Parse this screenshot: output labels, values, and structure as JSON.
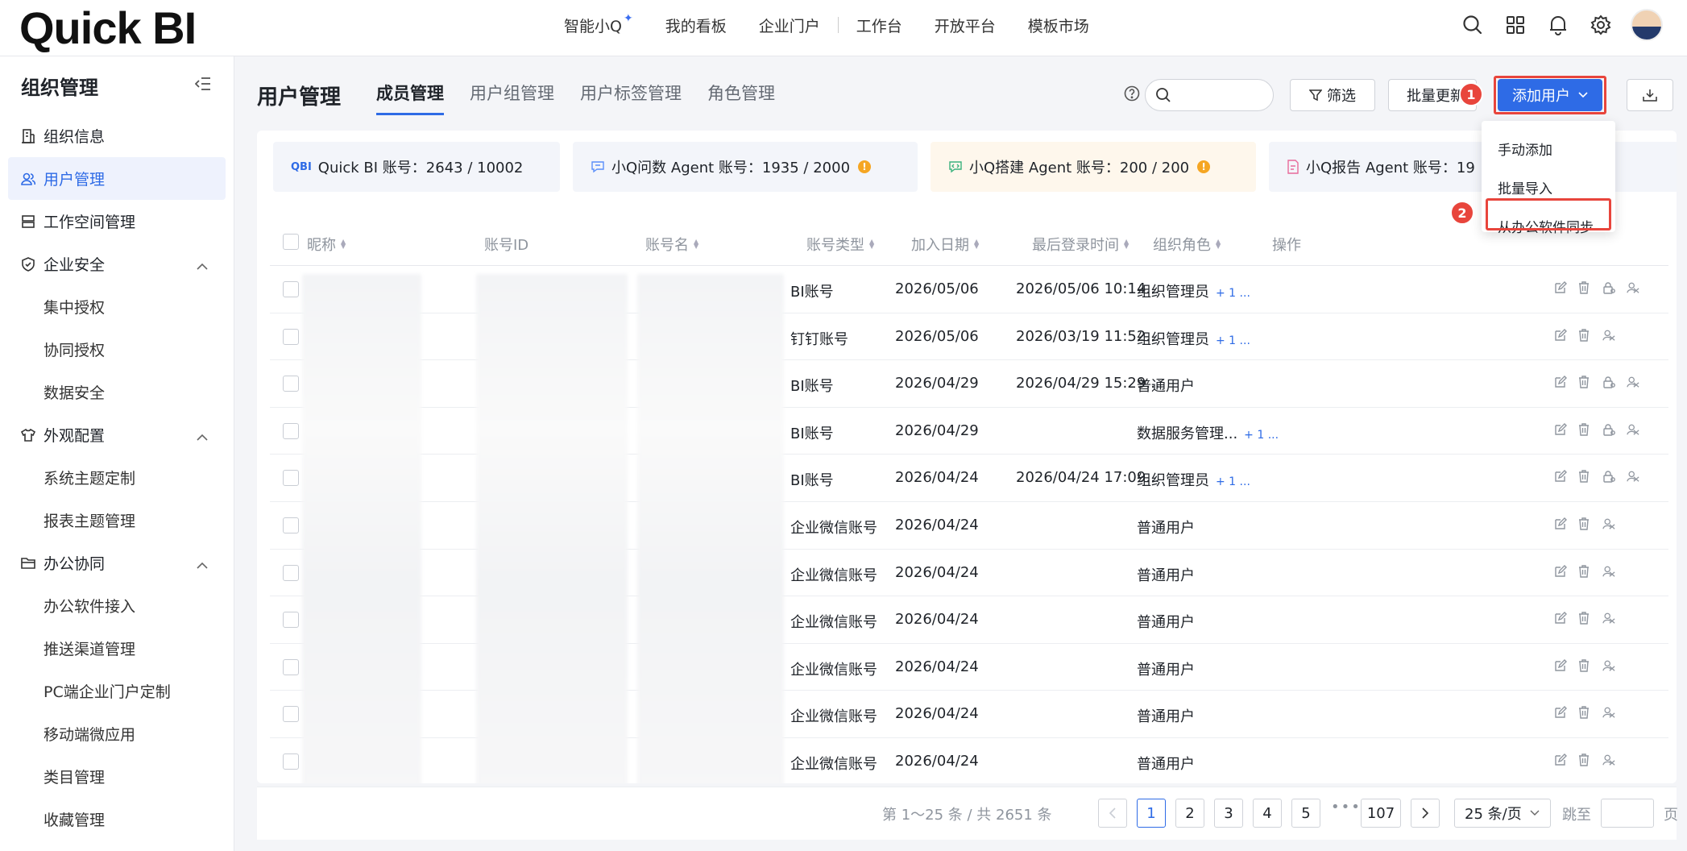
{
  "app": {
    "logo": "Quick BI"
  },
  "nav": {
    "items": [
      "智能小Q",
      "我的看板",
      "企业门户",
      "工作台",
      "开放平台",
      "模板市场"
    ]
  },
  "sidebar": {
    "title": "组织管理",
    "items": [
      {
        "label": "组织信息"
      },
      {
        "label": "用户管理"
      },
      {
        "label": "工作空间管理"
      },
      {
        "label": "企业安全"
      },
      {
        "label": "集中授权"
      },
      {
        "label": "协同授权"
      },
      {
        "label": "数据安全"
      },
      {
        "label": "外观配置"
      },
      {
        "label": "系统主题定制"
      },
      {
        "label": "报表主题管理"
      },
      {
        "label": "办公协同"
      },
      {
        "label": "办公软件接入"
      },
      {
        "label": "推送渠道管理"
      },
      {
        "label": "PC端企业门户定制"
      },
      {
        "label": "移动端微应用"
      },
      {
        "label": "类目管理"
      },
      {
        "label": "收藏管理"
      }
    ]
  },
  "main": {
    "title": "用户管理",
    "tabs": [
      "成员管理",
      "用户组管理",
      "用户标签管理",
      "角色管理"
    ],
    "toolbar": {
      "search_placeholder": "",
      "filter_label": "筛选",
      "bulk_label": "批量更新",
      "add_label": "添加用户"
    },
    "steps": [
      "1",
      "2"
    ],
    "dropdown": [
      "手动添加",
      "批量导入",
      "从办公软件同步"
    ],
    "quota": [
      {
        "prefix": "QBI",
        "label": "Quick BI 账号：2643 / 10002"
      },
      {
        "label": "小Q问数 Agent 账号：1935 / 2000"
      },
      {
        "label": "小Q搭建 Agent 账号：200 / 200"
      },
      {
        "label": "小Q报告 Agent 账号：19"
      }
    ],
    "warn_glyph": "!"
  },
  "table": {
    "columns": [
      "昵称",
      "账号ID",
      "账号名",
      "账号类型",
      "加入日期",
      "最后登录时间",
      "组织角色",
      "操作"
    ],
    "rows": [
      {
        "type": "BI账号",
        "date": "2026/05/06",
        "last": "2026/05/06 10:14...",
        "role": "组织管理员",
        "more": "+ 1 ..."
      },
      {
        "type": "钉钉账号",
        "date": "2026/05/06",
        "last": "2026/03/19 11:52...",
        "role": "组织管理员",
        "more": "+ 1 ..."
      },
      {
        "type": "BI账号",
        "date": "2026/04/29",
        "last": "2026/04/29 15:29...",
        "role": "普通用户",
        "more": ""
      },
      {
        "type": "BI账号",
        "date": "2026/04/29",
        "last": "",
        "role": "数据服务管理...",
        "more": "+ 1 ..."
      },
      {
        "type": "BI账号",
        "date": "2026/04/24",
        "last": "2026/04/24 17:09...",
        "role": "组织管理员",
        "more": "+ 1 ..."
      },
      {
        "type": "企业微信账号",
        "date": "2026/04/24",
        "last": "",
        "role": "普通用户",
        "more": ""
      },
      {
        "type": "企业微信账号",
        "date": "2026/04/24",
        "last": "",
        "role": "普通用户",
        "more": ""
      },
      {
        "type": "企业微信账号",
        "date": "2026/04/24",
        "last": "",
        "role": "普通用户",
        "more": ""
      },
      {
        "type": "企业微信账号",
        "date": "2026/04/24",
        "last": "",
        "role": "普通用户",
        "more": ""
      },
      {
        "type": "企业微信账号",
        "date": "2026/04/24",
        "last": "",
        "role": "普通用户",
        "more": ""
      },
      {
        "type": "企业微信账号",
        "date": "2026/04/24",
        "last": "",
        "role": "普通用户",
        "more": ""
      }
    ]
  },
  "pagination": {
    "total": "第 1～25 条 / 共 2651 条",
    "pages": [
      "1",
      "2",
      "3",
      "4",
      "5"
    ],
    "last_page": "107",
    "ellipsis": "•••",
    "page_size": "25 条/页",
    "jump_label": "跳至",
    "page_suffix": "页"
  }
}
